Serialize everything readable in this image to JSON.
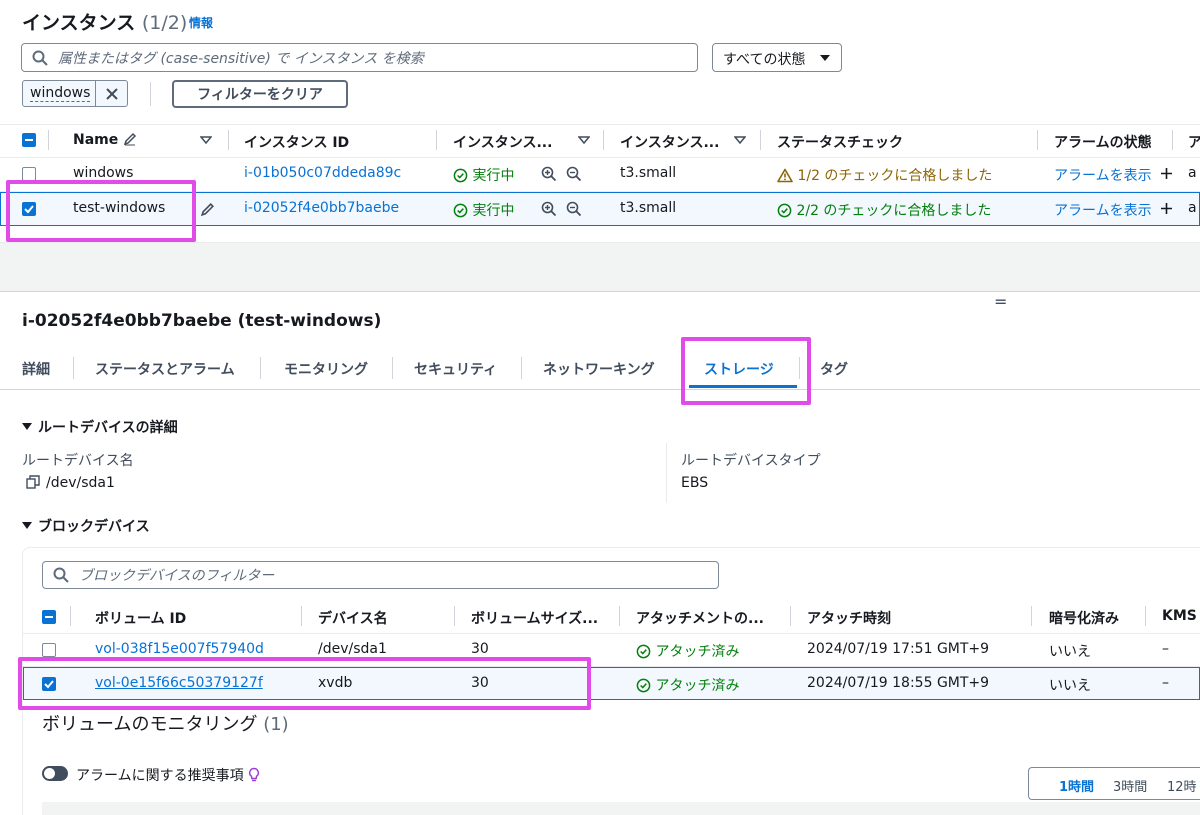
{
  "header": {
    "title": "インスタンス",
    "count": "(1/2)",
    "info_link": "情報"
  },
  "filter": {
    "search_placeholder": "属性またはタグ (case-sensitive) で インスタンス を検索",
    "state_select": "すべての状態",
    "token": "windows",
    "clear_button": "フィルターをクリア"
  },
  "instances_table": {
    "columns": [
      "Name",
      "インスタンス ID",
      "インスタンス...",
      "インスタンス...",
      "ステータスチェック",
      "アラームの状態",
      "ア"
    ],
    "rows": [
      {
        "name": "windows",
        "id": "i-01b050c07ddeda89c",
        "state": "実行中",
        "type": "t3.small",
        "status": "1/2 のチェックに合格しました",
        "alarm": "アラームを表示",
        "extra": "a",
        "selected": false
      },
      {
        "name": "test-windows",
        "id": "i-02052f4e0bb7baebe",
        "state": "実行中",
        "type": "t3.small",
        "status": "2/2 のチェックに合格しました",
        "alarm": "アラームを表示",
        "extra": "a",
        "selected": true
      }
    ]
  },
  "details": {
    "title": "i-02052f4e0bb7baebe (test-windows)",
    "drag_handle": "=",
    "tabs": [
      "詳細",
      "ステータスとアラーム",
      "モニタリング",
      "セキュリティ",
      "ネットワーキング",
      "ストレージ",
      "タグ"
    ],
    "active_tab": "ストレージ"
  },
  "root_device": {
    "section_title": "ルートデバイスの詳細",
    "name_label": "ルートデバイス名",
    "name_value": "/dev/sda1",
    "type_label": "ルートデバイスタイプ",
    "type_value": "EBS"
  },
  "block_devices": {
    "section_title": "ブロックデバイス",
    "filter_placeholder": "ブロックデバイスのフィルター",
    "columns": [
      "ボリューム ID",
      "デバイス名",
      "ボリュームサイズ...",
      "アタッチメントの...",
      "アタッチ時刻",
      "暗号化済み",
      "KMS"
    ],
    "rows": [
      {
        "volume_id": "vol-038f15e007f57940d",
        "device": "/dev/sda1",
        "size": "30",
        "attachment": "アタッチ済み",
        "time": "2024/07/19 17:51 GMT+9",
        "encrypted": "いいえ",
        "kms": "–",
        "selected": false
      },
      {
        "volume_id": "vol-0e15f66c50379127f",
        "device": "xvdb",
        "size": "30",
        "attachment": "アタッチ済み",
        "time": "2024/07/19 18:55 GMT+9",
        "encrypted": "いいえ",
        "kms": "–",
        "selected": true
      }
    ]
  },
  "volume_monitoring": {
    "title": "ボリュームのモニタリング",
    "count": "(1)",
    "toggle_label": "アラームに関する推奨事項",
    "time_ranges": [
      "1時間",
      "3時間",
      "12時"
    ]
  },
  "colors": {
    "accent": "#0972d3",
    "success": "#037f0c",
    "warning": "#8d6605",
    "highlight": "#e14be8"
  }
}
